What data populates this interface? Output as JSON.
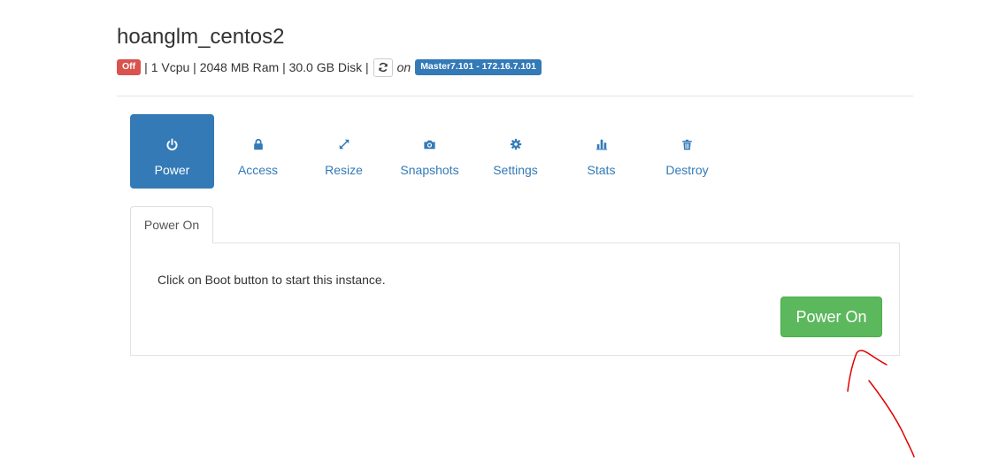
{
  "instance": {
    "name": "hoanglm_centos2",
    "status": "Off",
    "specs": "| 1 Vcpu | 2048 MB Ram | 30.0 GB Disk |",
    "on_label": "on",
    "host": "Master7.101 - 172.16.7.101"
  },
  "actions": [
    {
      "label": "Power",
      "icon": "power-icon",
      "active": true
    },
    {
      "label": "Access",
      "icon": "lock-icon",
      "active": false
    },
    {
      "label": "Resize",
      "icon": "resize-icon",
      "active": false
    },
    {
      "label": "Snapshots",
      "icon": "camera-icon",
      "active": false
    },
    {
      "label": "Settings",
      "icon": "gear-icon",
      "active": false
    },
    {
      "label": "Stats",
      "icon": "stats-icon",
      "active": false
    },
    {
      "label": "Destroy",
      "icon": "trash-icon",
      "active": false
    }
  ],
  "subtab": {
    "label": "Power On"
  },
  "panel": {
    "message": "Click on Boot button to start this instance.",
    "button_label": "Power On"
  },
  "colors": {
    "primary": "#337ab7",
    "danger": "#d9534f",
    "success": "#5cb85c",
    "annotation": "#e00000"
  }
}
